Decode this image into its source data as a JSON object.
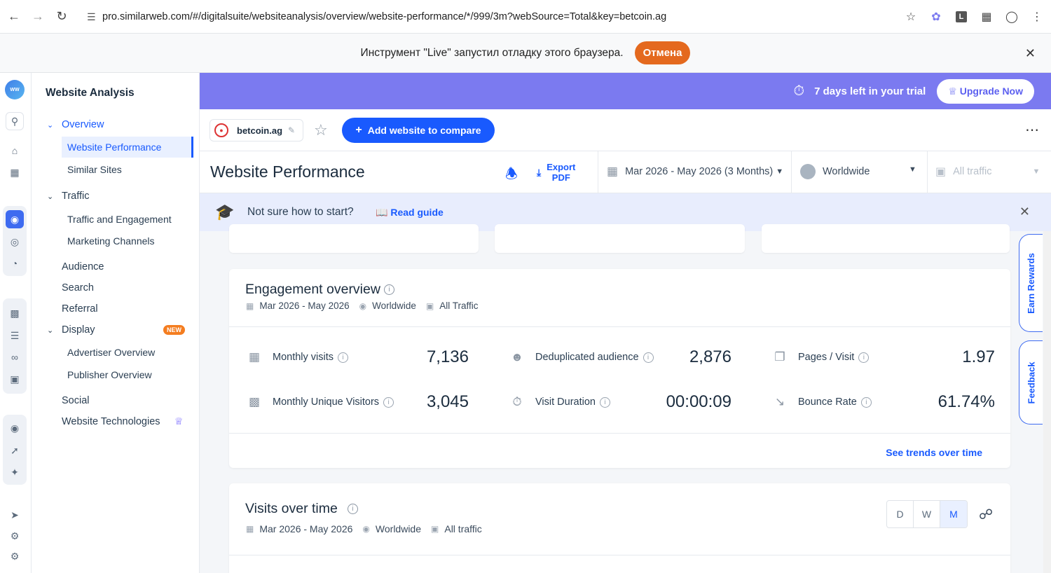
{
  "browser": {
    "url": "pro.similarweb.com/#/digitalsuite/websiteanalysis/overview/website-performance/*/999/3m?webSource=Total&key=betcoin.ag"
  },
  "debug_bar": {
    "message": "Инструмент \"Live\" запустил отладку этого браузера.",
    "cancel_label": "Отмена"
  },
  "sidebar": {
    "title": "Website Analysis",
    "overview": "Overview",
    "website_performance": "Website Performance",
    "similar_sites": "Similar Sites",
    "traffic": "Traffic",
    "traffic_engagement": "Traffic and Engagement",
    "marketing_channels": "Marketing Channels",
    "audience": "Audience",
    "search": "Search",
    "referral": "Referral",
    "display": "Display",
    "new_badge": "NEW",
    "advertiser_overview": "Advertiser Overview",
    "publisher_overview": "Publisher Overview",
    "social": "Social",
    "website_technologies": "Website Technologies"
  },
  "trial": {
    "text": "7 days left in your trial",
    "upgrade_label": "Upgrade Now"
  },
  "site_bar": {
    "domain": "betcoin.ag",
    "add_compare_label": "Add website to compare"
  },
  "page_header": {
    "title": "Website Performance",
    "export_line1": "Export",
    "export_line2": "PDF",
    "date_range": "Mar 2026 - May 2026 (3 Months)",
    "region": "Worldwide",
    "traffic": "All traffic"
  },
  "guide": {
    "question": "Not sure how to start?",
    "read_guide": "Read guide"
  },
  "engagement": {
    "title": "Engagement overview",
    "date": "Mar 2026 - May 2026",
    "region": "Worldwide",
    "traffic": "All Traffic",
    "metrics": [
      {
        "label": "Monthly visits",
        "value": "7,136"
      },
      {
        "label": "Deduplicated audience",
        "value": "2,876"
      },
      {
        "label": "Pages / Visit",
        "value": "1.97"
      },
      {
        "label": "Monthly Unique Visitors",
        "value": "3,045"
      },
      {
        "label": "Visit Duration",
        "value": "00:00:09"
      },
      {
        "label": "Bounce Rate",
        "value": "61.74%"
      }
    ],
    "trends_link": "See trends over time"
  },
  "visits": {
    "title": "Visits over time",
    "date": "Mar 2026 - May 2026",
    "region": "Worldwide",
    "traffic": "All traffic",
    "granularity": [
      "D",
      "W",
      "M"
    ]
  },
  "side_tabs": {
    "earn_rewards": "Earn Rewards",
    "feedback": "Feedback"
  }
}
